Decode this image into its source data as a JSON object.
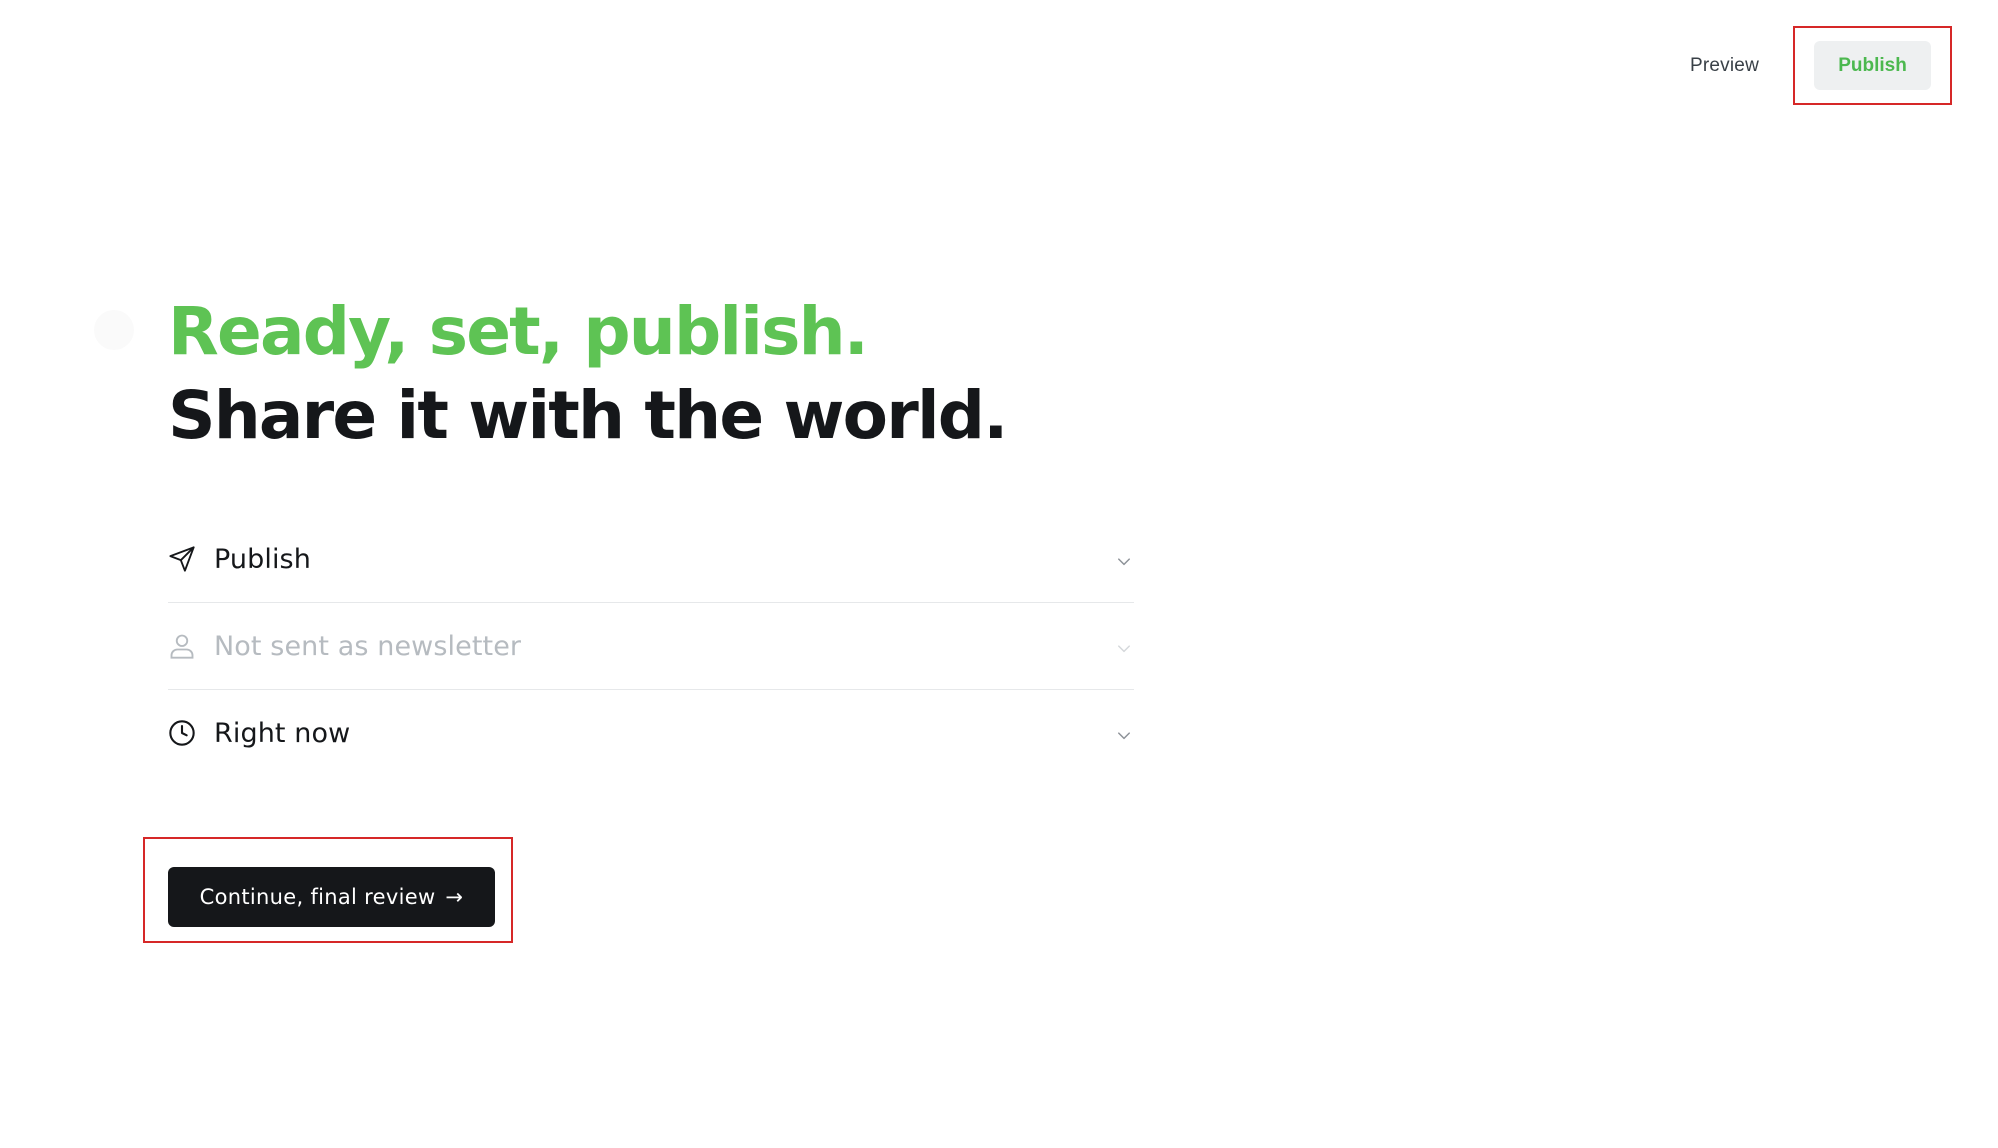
{
  "header": {
    "preview_label": "Preview",
    "publish_label": "Publish"
  },
  "headline": {
    "line1": "Ready, set, publish.",
    "line2": "Share it with the world."
  },
  "options": [
    {
      "label": "Publish",
      "icon": "send-icon",
      "state": "active"
    },
    {
      "label": "Not sent as newsletter",
      "icon": "user-icon",
      "state": "muted"
    },
    {
      "label": "Right now",
      "icon": "clock-icon",
      "state": "active"
    }
  ],
  "continue": {
    "label": "Continue, final review",
    "arrow": "→"
  },
  "colors": {
    "accent_green": "#5ec354",
    "text_dark": "#15171a",
    "muted": "#b6bbc0",
    "button_dark": "#15171a",
    "highlight_red": "#d62828"
  }
}
